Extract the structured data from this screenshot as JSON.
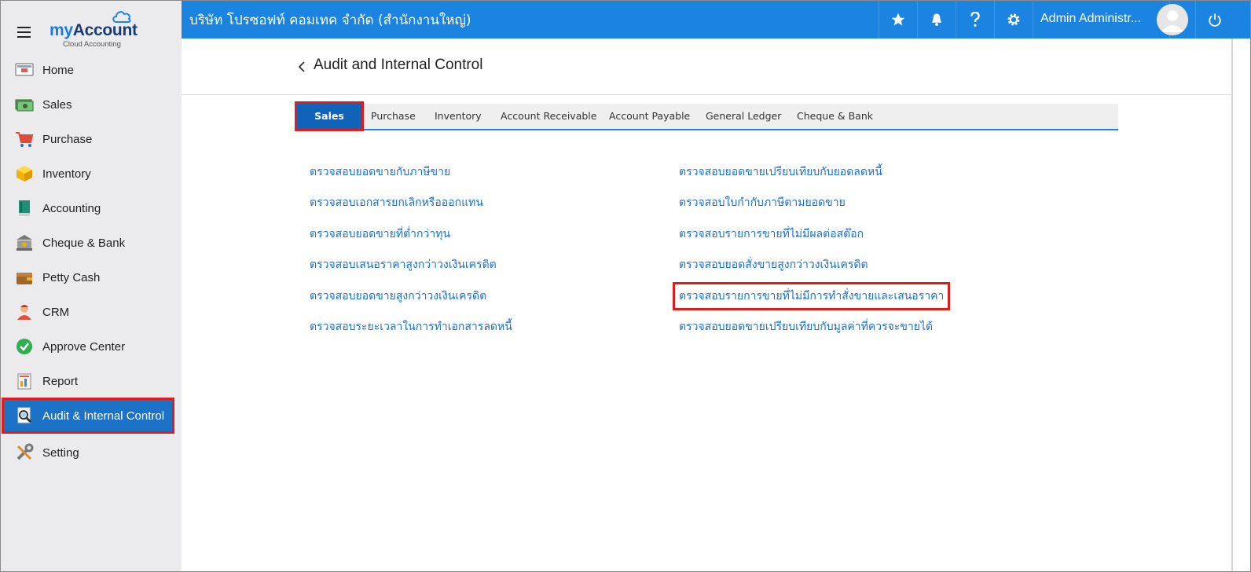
{
  "brand": {
    "name_part1": "my",
    "name_part2": "Account",
    "subtitle": "Cloud Accounting"
  },
  "sidebar": {
    "items": [
      {
        "label": "Home",
        "icon": "home-icon"
      },
      {
        "label": "Sales",
        "icon": "sales-money-icon"
      },
      {
        "label": "Purchase",
        "icon": "cart-icon"
      },
      {
        "label": "Inventory",
        "icon": "box-icon"
      },
      {
        "label": "Accounting",
        "icon": "book-icon"
      },
      {
        "label": "Cheque & Bank",
        "icon": "bank-icon"
      },
      {
        "label": "Petty Cash",
        "icon": "wallet-icon"
      },
      {
        "label": "CRM",
        "icon": "people-icon"
      },
      {
        "label": "Approve Center",
        "icon": "check-circle-icon"
      },
      {
        "label": "Report",
        "icon": "report-icon"
      },
      {
        "label": "Audit & Internal Control",
        "icon": "audit-icon",
        "active": true
      },
      {
        "label": "Setting",
        "icon": "tools-icon"
      }
    ]
  },
  "topbar": {
    "company": "บริษัท โปรซอฟท์ คอมเทค จำกัด (สำนักงานใหญ่)",
    "user": "Admin Administr...",
    "icons": [
      "star-icon",
      "bell-icon",
      "help-icon",
      "gear-icon",
      "power-icon"
    ]
  },
  "page": {
    "title": "Audit and Internal Control",
    "tabs": [
      {
        "label": "Sales",
        "active": true
      },
      {
        "label": "Purchase"
      },
      {
        "label": "Inventory"
      },
      {
        "label": "Account Receivable"
      },
      {
        "label": "Account Payable"
      },
      {
        "label": "General Ledger"
      },
      {
        "label": "Cheque & Bank"
      }
    ],
    "links_left": [
      "ตรวจสอบยอดขายกับภาษีขาย",
      "ตรวจสอบเอกสารยกเลิกหรือออกแทน",
      "ตรวจสอบยอดขายที่ต่ำกว่าทุน",
      "ตรวจสอบเสนอราคาสูงกว่าวงเงินเครดิต",
      "ตรวจสอบยอดขายสูงกว่าวงเงินเครดิต",
      "ตรวจสอบระยะเวลาในการทำเอกสารลดหนี้"
    ],
    "links_right": [
      "ตรวจสอบยอดขายเปรียบเทียบกับยอดลดหนี้",
      "ตรวจสอบใบกำกับภาษีตามยอดขาย",
      "ตรวจสอบรายการขายที่ไม่มีผลต่อสต๊อก",
      "ตรวจสอบยอดสั่งขายสูงกว่าวงเงินเครดิต",
      "ตรวจสอบรายการขายที่ไม่มีการทำสั่งขายและเสนอราคา",
      "ตรวจสอบยอดขายเปรียบเทียบกับมูลค่าที่ควรจะขายได้"
    ]
  },
  "colors": {
    "topbar": "#1a84e0",
    "active": "#1b72c6",
    "highlight": "#e21c1c",
    "link": "#1a6fd0",
    "sidebar": "#ebebed"
  }
}
